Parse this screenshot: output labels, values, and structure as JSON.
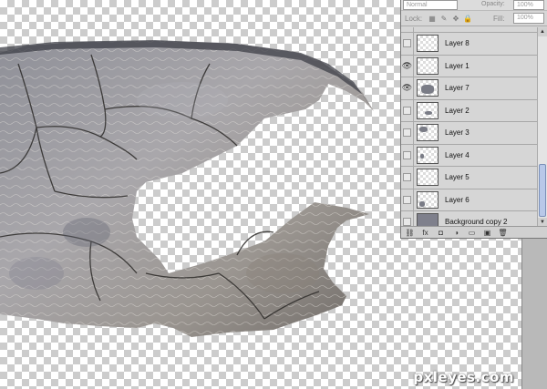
{
  "panel": {
    "blend_mode": "Normal",
    "opacity_label": "Opacity:",
    "opacity_value": "100%",
    "lock_label": "Lock:",
    "fill_label": "Fill:",
    "fill_value": "100%",
    "lock_icons": [
      "lock-transparency-icon",
      "lock-paint-icon",
      "lock-move-icon",
      "lock-all-icon"
    ],
    "layers": [
      {
        "name": "Layer 8",
        "visible": false
      },
      {
        "name": "Layer 1",
        "visible": true
      },
      {
        "name": "Layer 7",
        "visible": true
      },
      {
        "name": "Layer 2",
        "visible": false
      },
      {
        "name": "Layer 3",
        "visible": false
      },
      {
        "name": "Layer 4",
        "visible": false
      },
      {
        "name": "Layer 5",
        "visible": false
      },
      {
        "name": "Layer 6",
        "visible": false
      },
      {
        "name": "Background copy 2",
        "visible": false
      }
    ],
    "bottom_icons": [
      "link-layers-icon",
      "fx-icon",
      "add-mask-icon",
      "adjustment-layer-icon",
      "new-group-icon",
      "new-layer-icon",
      "delete-layer-icon"
    ],
    "bottom_glyphs": [
      "⛓",
      "fx",
      "◘",
      "◑",
      "▭",
      "▣",
      "🗑"
    ]
  },
  "watermark": "pxleyes.com"
}
